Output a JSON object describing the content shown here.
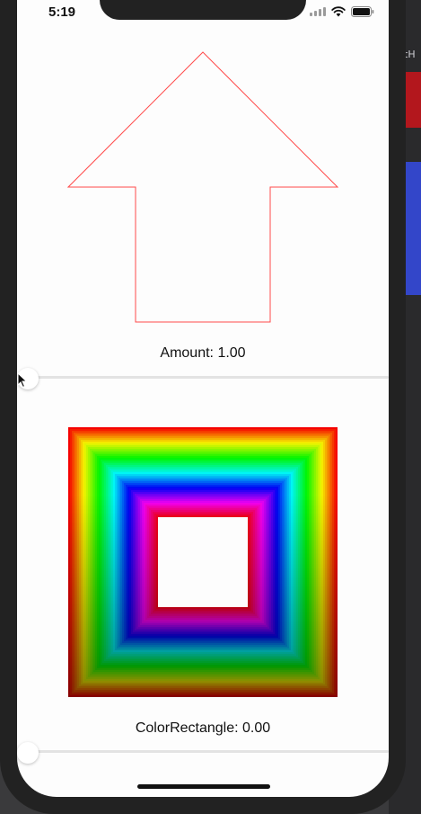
{
  "status_bar": {
    "time": "5:19"
  },
  "background": {
    "partial_text": "itH"
  },
  "colors": {
    "arrow_stroke": "#ff4a4a",
    "bg_red": "#b3171d",
    "bg_blue": "#3346c9"
  },
  "icons": {
    "signal": "cellular-signal-icon",
    "wifi": "wifi-icon",
    "battery": "battery-icon",
    "cursor": "mouse-pointer-icon"
  },
  "arrow_section": {
    "caption": "Amount: 1.00",
    "slider_value": 0.0
  },
  "rect_section": {
    "caption": "ColorRectangle: 0.00",
    "slider_value": 0.0
  }
}
